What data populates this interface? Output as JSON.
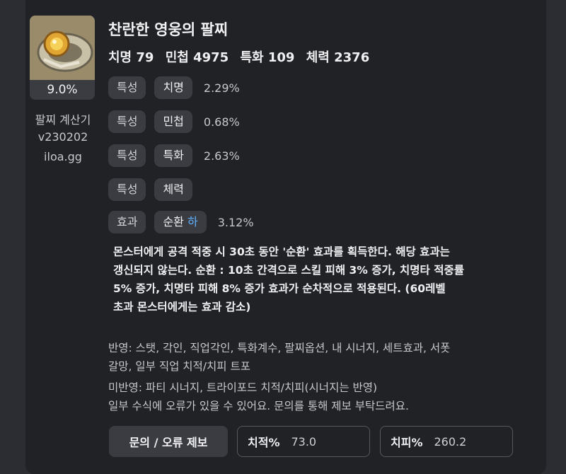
{
  "item": {
    "name": "찬란한 영웅의 팔찌",
    "percent_badge": "9.0%",
    "stats": [
      "치명 79",
      "민첩 4975",
      "특화 109",
      "체력 2376"
    ]
  },
  "sidebar": {
    "calc_title": "팔찌 계산기",
    "version": "v230202",
    "site": "iloa.gg"
  },
  "rows": [
    {
      "kind": "특성",
      "name": "치명",
      "value": "2.29%"
    },
    {
      "kind": "특성",
      "name": "민첩",
      "value": "0.68%"
    },
    {
      "kind": "특성",
      "name": "특화",
      "value": "2.63%"
    },
    {
      "kind": "특성",
      "name": "체력",
      "value": ""
    },
    {
      "kind": "효과",
      "name": "순환",
      "grade": "하",
      "value": "3.12%"
    }
  ],
  "effect_description": [
    "몬스터에게 공격 적중 시 30초 동안 '순환' 효과를 획득한다. 해당 효과는",
    "갱신되지 않는다. 순환 : 10초 간격으로 스킬 피해 3% 증가, 치명타 적중률",
    "5% 증가, 치명타 피해 8% 증가 효과가 순차적으로 적용된다. (60레벨",
    "초과 몬스터에게는 효과 감소)"
  ],
  "notes": {
    "reflected_1": "반영: 스탯, 각인, 직업각인, 특화계수, 팔찌옵션, 내 시너지, 세트효과, 서폿",
    "reflected_2": "갈망, 일부 직업 치적/치피 트포",
    "unreflected": "미반영: 파티 시너지, 트라이포드 치적/치피(시너지는 반영)",
    "disclaimer": "일부 수식에 오류가 있을 수 있어요. 문의를 통해 제보 부탁드려요."
  },
  "footer": {
    "report_button": "문의 / 오류 제보",
    "crit_rate_label": "치적%",
    "crit_rate_value": "73.0",
    "crit_dmg_label": "치피%",
    "crit_dmg_value": "260.2"
  },
  "colors": {
    "background": "#202226",
    "pill": "#3a3c42",
    "grade_accent": "#5fb0ff"
  },
  "icons": {
    "item": "bracelet-icon"
  }
}
